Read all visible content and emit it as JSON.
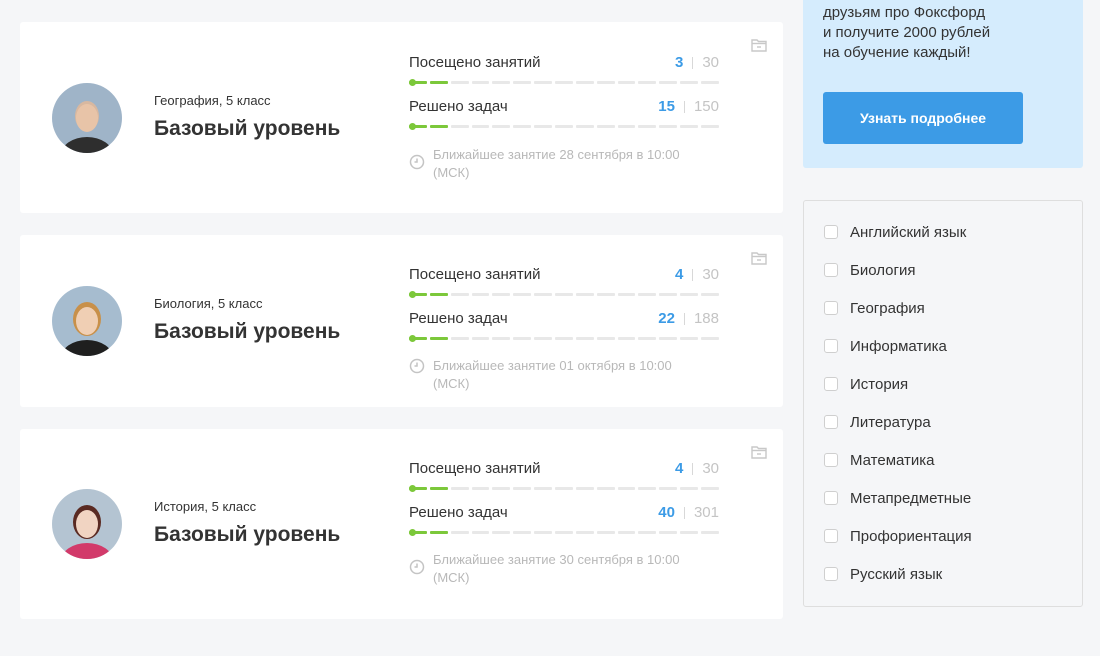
{
  "courses": [
    {
      "subject": "География, 5 класс",
      "level": "Базовый уровень",
      "visited": {
        "label": "Посещено занятий",
        "current": "3",
        "total": "30",
        "progress": 0.1
      },
      "solved": {
        "label": "Решено задач",
        "current": "15",
        "total": "150",
        "progress": 0.1
      },
      "next_lesson": "Ближайшее занятие 28 сентября в 10:00 (МСК)"
    },
    {
      "subject": "Биология, 5 класс",
      "level": "Базовый уровень",
      "visited": {
        "label": "Посещено занятий",
        "current": "4",
        "total": "30",
        "progress": 0.133
      },
      "solved": {
        "label": "Решено задач",
        "current": "22",
        "total": "188",
        "progress": 0.117
      },
      "next_lesson": "Ближайшее занятие 01 октября в 10:00 (МСК)"
    },
    {
      "subject": "История, 5 класс",
      "level": "Базовый уровень",
      "visited": {
        "label": "Посещено занятий",
        "current": "4",
        "total": "30",
        "progress": 0.133
      },
      "solved": {
        "label": "Решено задач",
        "current": "40",
        "total": "301",
        "progress": 0.133
      },
      "next_lesson": "Ближайшее занятие 30 сентября в 10:00 (МСК)"
    }
  ],
  "promo": {
    "text": "друзьям про Фоксфорд\nи получите 2000 рублей\nна обучение каждый!",
    "button": "Узнать подробнее"
  },
  "filters": [
    "Английский язык",
    "Биология",
    "География",
    "Информатика",
    "История",
    "Литература",
    "Математика",
    "Метапредметные",
    "Профориентация",
    "Русский язык"
  ],
  "colors": {
    "accent": "#3c9be6",
    "progress": "#7cc83a",
    "promo_bg": "#d5ecfd"
  },
  "icons": {
    "archive": "folder-icon",
    "clock": "clock-icon"
  }
}
